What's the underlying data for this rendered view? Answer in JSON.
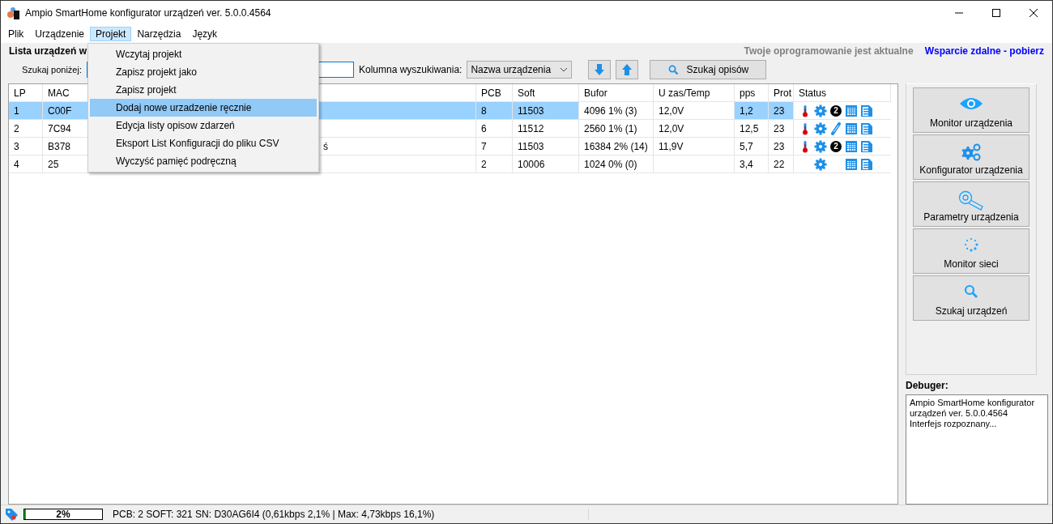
{
  "window": {
    "title": "Ampio SmartHome konfigurator urządzeń ver. 5.0.0.4564"
  },
  "menu": [
    {
      "label": "Plik",
      "selected": false
    },
    {
      "label": "Urządzenie",
      "selected": false
    },
    {
      "label": "Projekt",
      "selected": true
    },
    {
      "label": "Narzędzia",
      "selected": false
    },
    {
      "label": "Język",
      "selected": false
    }
  ],
  "dropdown_menu": [
    {
      "label": "Wczytaj projekt",
      "selected": false
    },
    {
      "label": "Zapisz projekt jako",
      "selected": false
    },
    {
      "label": "Zapisz projekt",
      "selected": false
    },
    {
      "label": "Dodaj nowe urzadzenie ręcznie",
      "selected": true
    },
    {
      "label": "Edycja listy opisow zdarzeń",
      "selected": false
    },
    {
      "label": "Eksport List Konfiguracji do pliku CSV",
      "selected": false
    },
    {
      "label": "Wyczyść pamięć podręczną",
      "selected": false
    }
  ],
  "toolbar": {
    "list_title": "Lista urządzeń w",
    "search_label": "Szukaj poniżej:",
    "column_label": "Kolumna wyszukiwania:",
    "column_select": "Nazwa urządzenia",
    "search_button": "Szukaj opisów",
    "update_status": "Twoje oprogramowanie jest aktualne",
    "support_link": "Wsparcie zdalne - pobierz"
  },
  "table": {
    "columns": [
      "LP",
      "MAC",
      "",
      "PCB",
      "Soft",
      "Bufor",
      "U zas/Temp",
      "pps",
      "Prot",
      "Status"
    ],
    "rows": [
      {
        "selected": true,
        "cells": [
          "1",
          "C00F",
          "",
          "8",
          "11503",
          "4096 1% (3)",
          "12,0V",
          "1,2",
          "23"
        ],
        "status": [
          {
            "kind": "thermometer"
          },
          {
            "kind": "gear"
          },
          {
            "kind": "badge",
            "text": "2"
          },
          {
            "kind": "calendar"
          },
          {
            "kind": "list"
          }
        ]
      },
      {
        "selected": false,
        "cells": [
          "2",
          "7C94",
          "",
          "6",
          "11512",
          "2560 1% (1)",
          "12,0V",
          "12,5",
          "23"
        ],
        "status": [
          {
            "kind": "thermometer"
          },
          {
            "kind": "gear"
          },
          {
            "kind": "link"
          },
          {
            "kind": "calendar"
          },
          {
            "kind": "list"
          }
        ]
      },
      {
        "selected": false,
        "cells": [
          "3",
          "B378",
          "ś",
          "7",
          "11503",
          "16384 2% (14)",
          "11,9V",
          "5,7",
          "23"
        ],
        "status": [
          {
            "kind": "thermometer"
          },
          {
            "kind": "gear"
          },
          {
            "kind": "badge",
            "text": "2"
          },
          {
            "kind": "calendar"
          },
          {
            "kind": "list"
          }
        ]
      },
      {
        "selected": false,
        "cells": [
          "4",
          "25",
          "",
          "2",
          "10006",
          "1024 0% (0)",
          "",
          "3,4",
          "22"
        ],
        "status": [
          {
            "kind": "blank"
          },
          {
            "kind": "gear"
          },
          {
            "kind": "blank"
          },
          {
            "kind": "calendar"
          },
          {
            "kind": "list"
          }
        ]
      }
    ]
  },
  "side_buttons": [
    {
      "kind": "eye",
      "label": "Monitor urządzenia"
    },
    {
      "kind": "gears",
      "label": "Konfigurator urządzenia"
    },
    {
      "kind": "wrench",
      "label": "Parametry urządzenia"
    },
    {
      "kind": "spinner",
      "label": "Monitor sieci"
    },
    {
      "kind": "search",
      "label": "Szukaj urządzeń"
    }
  ],
  "debugger": {
    "label": "Debuger:",
    "text": "Ampio SmartHome konfigurator urządzeń ver. 5.0.0.4564\nInterfejs rozpoznany..."
  },
  "status_bar": {
    "progress": {
      "level": 0.02,
      "text": "2%"
    },
    "info": "PCB: 2 SOFT: 321 SN: D30AG6I4 (0,61kbps 2,1% | Max: 4,73kbps 16,1%)"
  }
}
